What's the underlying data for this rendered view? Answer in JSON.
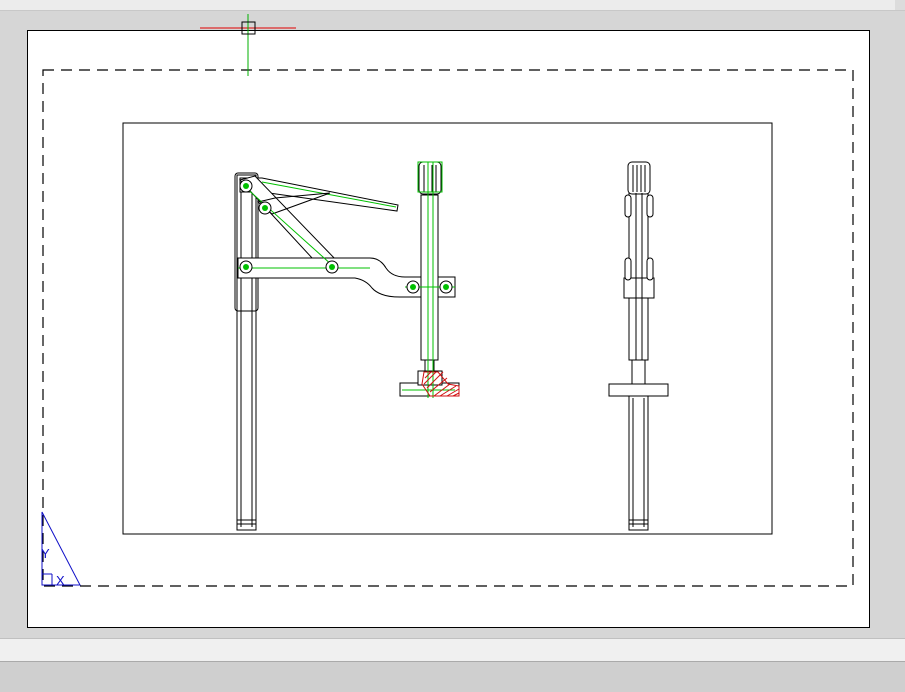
{
  "colors": {
    "background": "#d6d6d6",
    "paper": "#ffffff",
    "outline": "#000000",
    "construction": "#00c000",
    "hatch": "#d01010",
    "crosshair_h": "#e00000",
    "crosshair_v": "#00b000",
    "ucs": "#1010c8"
  },
  "ucs_icon": {
    "y_label": "Y",
    "x_label": "X"
  },
  "cursor": {
    "icon": "crosshair-pickbox-icon"
  }
}
